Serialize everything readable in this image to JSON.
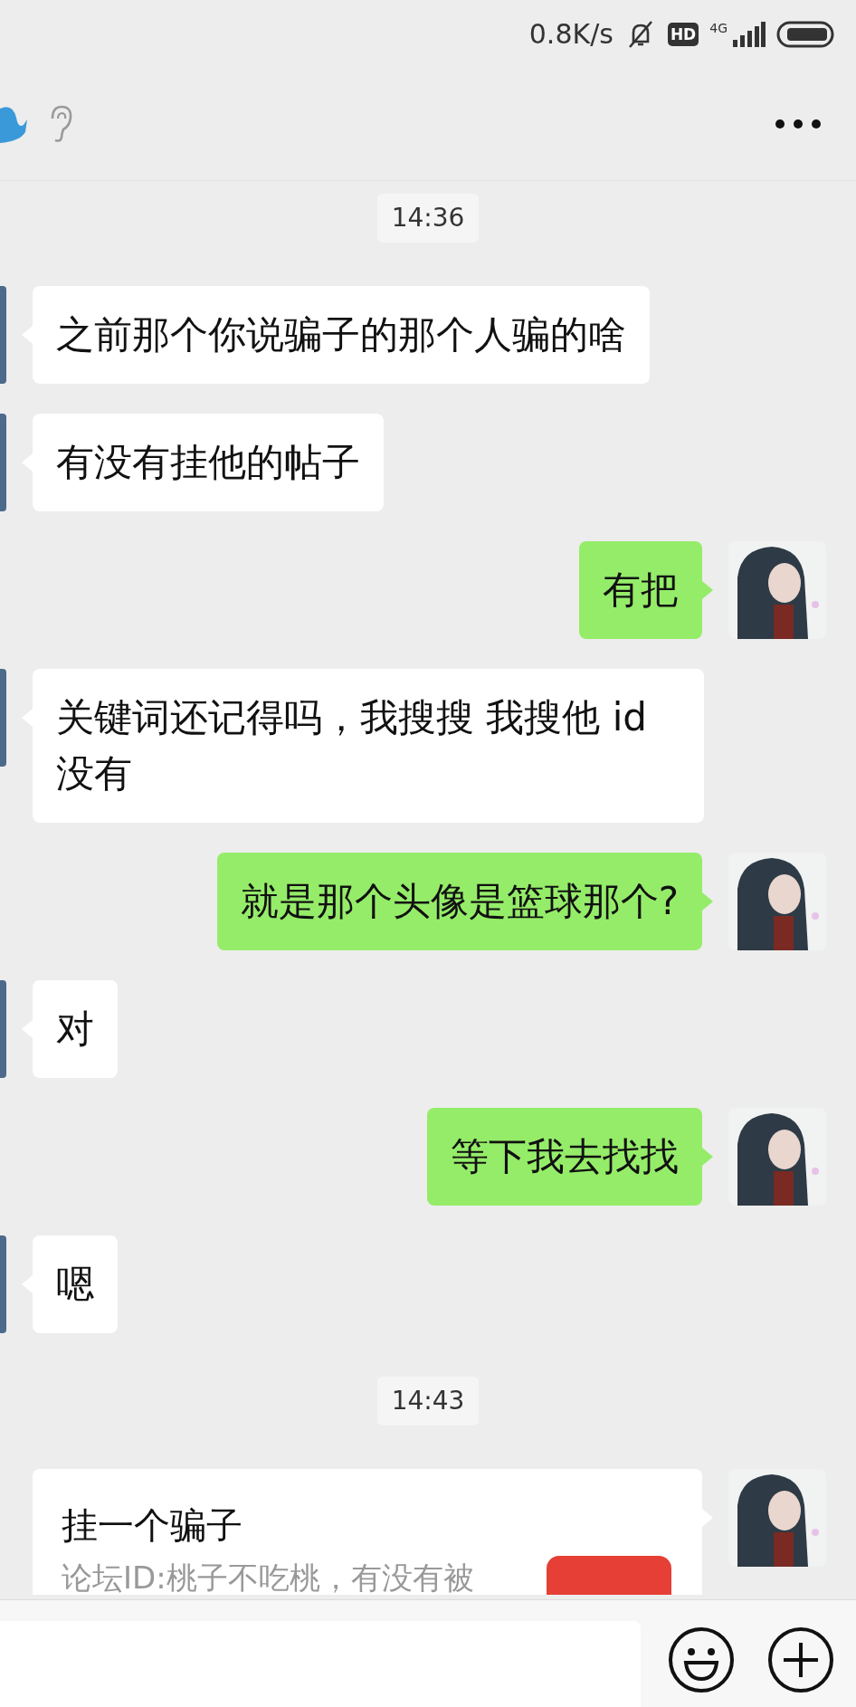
{
  "status_bar": {
    "network_speed": "0.8K/s",
    "hd_badge": "HD",
    "network_type": "4G"
  },
  "messages": [
    {
      "kind": "time",
      "text": "14:36"
    },
    {
      "kind": "incoming",
      "text": "之前那个你说骗子的那个人骗的啥"
    },
    {
      "kind": "incoming",
      "text": "有没有挂他的帖子"
    },
    {
      "kind": "outgoing",
      "text": "有把"
    },
    {
      "kind": "incoming",
      "text": "关键词还记得吗，我搜搜 我搜他 id没有"
    },
    {
      "kind": "outgoing",
      "text": "就是那个头像是篮球那个?"
    },
    {
      "kind": "incoming",
      "text": "对"
    },
    {
      "kind": "outgoing",
      "text": "等下我去找找"
    },
    {
      "kind": "incoming",
      "text": "嗯"
    },
    {
      "kind": "time",
      "text": "14:43"
    },
    {
      "kind": "card",
      "title": "挂一个骗子",
      "description": "论坛ID:桃子不吃桃，有没有被"
    }
  ]
}
